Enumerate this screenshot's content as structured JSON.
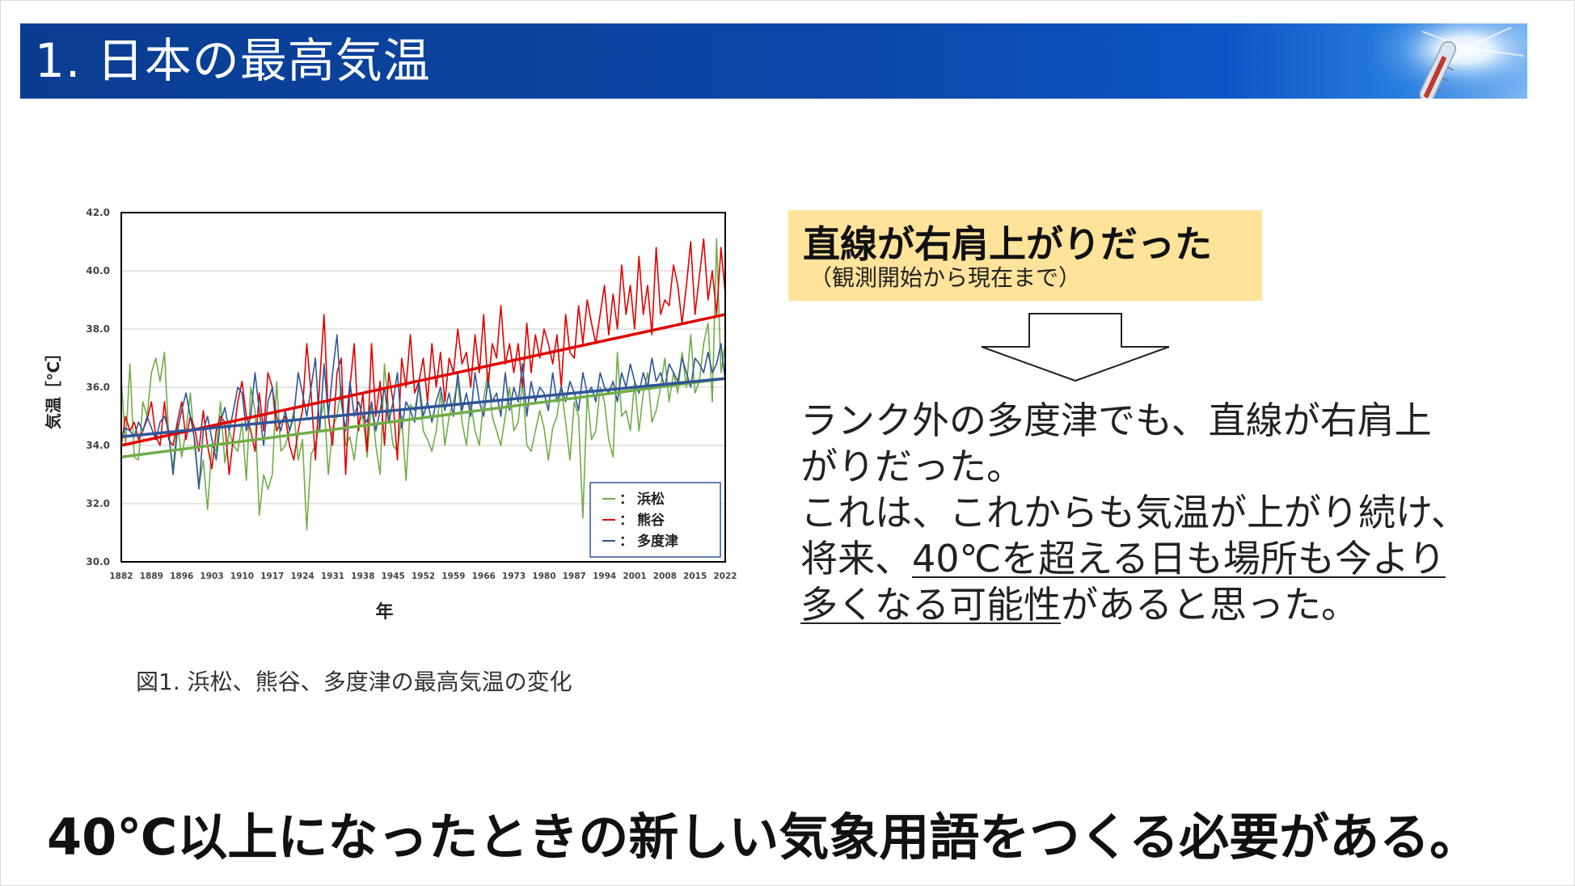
{
  "header": {
    "title": "1. 日本の最高気温"
  },
  "figure": {
    "caption": "図1. 浜松、熊谷、多度津の最高気温の変化"
  },
  "callout": {
    "heading": "直線が右肩上がりだった",
    "subheading": "（観測開始から現在まで）"
  },
  "body": {
    "line1": "ランク外の多度津でも、直線が右肩上",
    "line2": "がりだった。",
    "line3": "これは、これからも気温が上がり続け、",
    "line4a": "将来、",
    "line4b": "40℃を超える日も場所も今より",
    "line5a": "多くなる可能性",
    "line5b": "があると思った。"
  },
  "conclusion": "40℃以上になったときの新しい気象用語をつくる必要がある。",
  "chart_data": {
    "type": "line",
    "xlabel": "年",
    "ylabel": "気温［℃］",
    "xlim": [
      1882,
      2022
    ],
    "ylim": [
      30.0,
      42.0
    ],
    "yticks": [
      "30.0",
      "32.0",
      "34.0",
      "36.0",
      "38.0",
      "40.0",
      "42.0"
    ],
    "xticks": [
      "1882",
      "1889",
      "1896",
      "1903",
      "1910",
      "1917",
      "1924",
      "1931",
      "1938",
      "1945",
      "1952",
      "1959",
      "1966",
      "1973",
      "1980",
      "1987",
      "1994",
      "2001",
      "2008",
      "2015",
      "2022"
    ],
    "grid": true,
    "legend_position": "bottom-right",
    "series": [
      {
        "name": "浜松",
        "color": "#70ad47",
        "trend": [
          33.6,
          36.3
        ],
        "values": [
          36.3,
          34.0,
          36.8,
          33.6,
          33.5,
          35.5,
          35.0,
          36.5,
          37.0,
          36.2,
          37.2,
          34.3,
          33.2,
          34.8,
          33.6,
          34.5,
          35.8,
          34.0,
          32.6,
          33.5,
          31.8,
          34.0,
          33.8,
          35.5,
          33.4,
          34.5,
          34.0,
          33.8,
          34.8,
          32.8,
          36.0,
          35.2,
          31.6,
          33.0,
          32.5,
          33.0,
          36.2,
          33.8,
          34.0,
          34.5,
          35.2,
          33.5,
          34.2,
          31.1,
          33.7,
          34.0,
          34.8,
          35.5,
          33.0,
          34.6,
          35.0,
          36.0,
          34.0,
          34.3,
          33.5,
          34.8,
          35.0,
          33.6,
          35.5,
          34.0,
          33.0,
          36.8,
          35.2,
          34.0,
          33.8,
          35.0,
          32.8,
          35.4,
          35.2,
          36.0,
          34.5,
          34.2,
          33.8,
          34.5,
          35.8,
          34.0,
          35.0,
          35.5,
          36.2,
          34.8,
          34.0,
          35.5,
          34.5,
          34.0,
          35.6,
          36.5,
          35.0,
          34.5,
          34.0,
          35.0,
          36.0,
          34.5,
          34.8,
          36.2,
          34.0,
          33.8,
          34.5,
          35.2,
          34.6,
          33.5,
          34.6,
          35.0,
          36.0,
          34.8,
          33.5,
          35.5,
          35.0,
          31.5,
          35.8,
          34.2,
          34.5,
          36.0,
          35.5,
          34.2,
          33.6,
          37.2,
          35.0,
          35.2,
          34.5,
          36.2,
          34.5,
          35.8,
          36.5,
          34.8,
          35.2,
          36.0,
          37.0,
          35.5,
          36.5,
          35.8,
          37.2,
          36.0,
          37.8,
          35.8,
          36.2,
          37.5,
          38.2,
          35.5,
          41.1,
          36.5,
          37.5
        ]
      },
      {
        "name": "熊谷",
        "color": "#e00000",
        "trend": [
          34.0,
          38.5
        ],
        "values": [
          34.0,
          35.0,
          34.5,
          34.8,
          34.2,
          34.5,
          34.9,
          35.5,
          34.3,
          34.0,
          35.5,
          34.2,
          34.0,
          34.8,
          35.5,
          34.2,
          35.0,
          34.6,
          33.8,
          35.2,
          34.0,
          33.2,
          34.5,
          35.0,
          34.8,
          33.0,
          34.3,
          35.5,
          36.2,
          35.0,
          34.5,
          33.8,
          35.8,
          34.5,
          36.5,
          36.0,
          34.5,
          34.8,
          35.0,
          34.0,
          33.5,
          34.5,
          35.2,
          37.5,
          35.8,
          33.5,
          36.2,
          38.5,
          35.0,
          34.0,
          36.5,
          37.0,
          33.0,
          36.0,
          37.5,
          34.5,
          35.8,
          33.8,
          37.5,
          35.0,
          36.2,
          34.0,
          36.5,
          35.5,
          33.5,
          37.0,
          36.0,
          37.8,
          35.8,
          36.2,
          37.0,
          35.5,
          37.5,
          36.0,
          37.2,
          35.5,
          37.0,
          36.5,
          38.0,
          36.8,
          37.2,
          36.0,
          37.8,
          36.5,
          38.5,
          36.0,
          37.5,
          37.0,
          38.8,
          36.8,
          37.5,
          36.5,
          37.5,
          36.0,
          38.2,
          36.5,
          37.8,
          37.0,
          38.0,
          37.5,
          36.8,
          37.8,
          36.0,
          38.5,
          37.2,
          37.0,
          38.8,
          37.5,
          39.0,
          38.2,
          37.5,
          38.5,
          39.5,
          37.8,
          39.2,
          38.0,
          40.2,
          38.5,
          39.5,
          38.0,
          40.5,
          38.5,
          39.5,
          37.8,
          40.8,
          38.5,
          39.0,
          38.8,
          40.2,
          39.5,
          38.2,
          39.5,
          41.0,
          38.5,
          39.8,
          41.1,
          39.0,
          40.0,
          38.5,
          40.8,
          39.2
        ]
      },
      {
        "name": "多度津",
        "color": "#2f5597",
        "trend": [
          34.3,
          36.3
        ],
        "values": [
          34.3,
          34.6,
          34.5,
          34.3,
          34.8,
          34.5,
          35.0,
          34.6,
          34.2,
          34.8,
          35.0,
          34.5,
          33.0,
          34.5,
          35.2,
          35.8,
          35.0,
          34.2,
          32.5,
          34.5,
          35.0,
          34.2,
          33.5,
          34.8,
          35.3,
          34.5,
          35.2,
          36.0,
          35.8,
          34.5,
          35.0,
          36.5,
          35.2,
          34.0,
          35.5,
          36.0,
          35.0,
          34.5,
          35.2,
          34.5,
          35.0,
          36.5,
          35.8,
          35.0,
          36.0,
          37.0,
          34.5,
          36.8,
          35.0,
          36.5,
          37.8,
          35.5,
          34.5,
          36.2,
          35.0,
          35.5,
          35.0,
          34.8,
          35.5,
          34.5,
          35.2,
          36.0,
          34.8,
          35.5,
          36.5,
          34.6,
          35.5,
          35.2,
          34.8,
          36.2,
          35.0,
          35.5,
          34.8,
          35.5,
          36.0,
          35.2,
          35.8,
          35.0,
          36.5,
          35.2,
          35.8,
          35.0,
          36.5,
          35.5,
          35.0,
          36.2,
          35.5,
          35.8,
          35.0,
          36.5,
          35.2,
          36.0,
          35.5,
          36.8,
          35.0,
          36.2,
          35.5,
          36.0,
          35.8,
          35.2,
          36.5,
          35.5,
          36.0,
          35.5,
          36.2,
          35.8,
          35.2,
          36.5,
          35.8,
          36.0,
          35.5,
          36.5,
          36.0,
          35.8,
          36.2,
          35.5,
          36.5,
          36.0,
          36.8,
          36.2,
          35.8,
          36.5,
          36.0,
          37.0,
          36.2,
          36.5,
          36.0,
          36.8,
          36.5,
          36.2,
          37.0,
          36.5,
          36.0,
          37.0,
          36.8,
          36.5,
          37.2,
          36.5,
          36.8,
          37.5,
          36.2
        ]
      }
    ]
  }
}
